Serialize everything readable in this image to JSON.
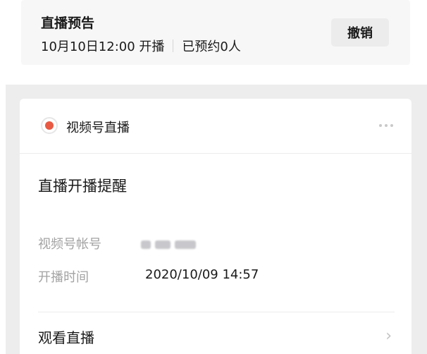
{
  "preview": {
    "title": "直播预告",
    "schedule": "10月10日12:00 开播",
    "booked": "已预约0人",
    "cancel_label": "撤销"
  },
  "message_card": {
    "header_label": "视频号直播",
    "title": "直播开播提醒",
    "account_label": "视频号帐号",
    "time_label": "开播时间",
    "time_value": "2020/10/09 14:57",
    "watch_label": "观看直播"
  },
  "colors": {
    "live_red": "#e85a43",
    "muted_text": "#a3a3a3"
  }
}
